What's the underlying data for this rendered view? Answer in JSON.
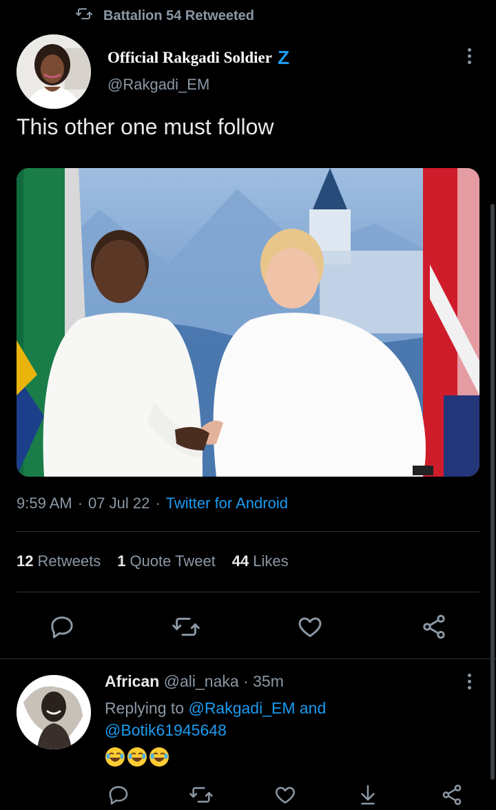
{
  "retweet_context": {
    "label": "Battalion 54 Retweeted",
    "icon": "retweet-icon"
  },
  "tweet": {
    "author_name": "Official Rakgadi Soldier",
    "badge": "Z",
    "handle": "@Rakgadi_EM",
    "text": "This other one must follow",
    "time": "9:59 AM",
    "sep1": "·",
    "date": "07 Jul 22",
    "sep2": "·",
    "source": "Twitter for Android",
    "stats": {
      "retweets_count": "12",
      "retweets_label": "Retweets",
      "quotes_count": "1",
      "quotes_label": "Quote Tweet",
      "likes_count": "44",
      "likes_label": "Likes"
    },
    "actions": [
      "reply-icon",
      "retweet-icon",
      "like-icon",
      "share-icon"
    ]
  },
  "reply": {
    "name": "African",
    "handle": "@ali_naka",
    "sep": "·",
    "age": "35m",
    "replying_to_label": "Replying to",
    "mention1": "@Rakgadi_EM",
    "and": "and",
    "mention2": "@Botik61945648",
    "emojis": [
      "😂",
      "😂",
      "😂"
    ],
    "actions": [
      "reply-icon",
      "retweet-icon",
      "like-icon",
      "download-icon",
      "share-icon"
    ]
  },
  "colors": {
    "background": "#000000",
    "text": "#e7e9ea",
    "muted": "#8b98a5",
    "accent": "#1d9bf0",
    "divider": "#2f3336"
  }
}
